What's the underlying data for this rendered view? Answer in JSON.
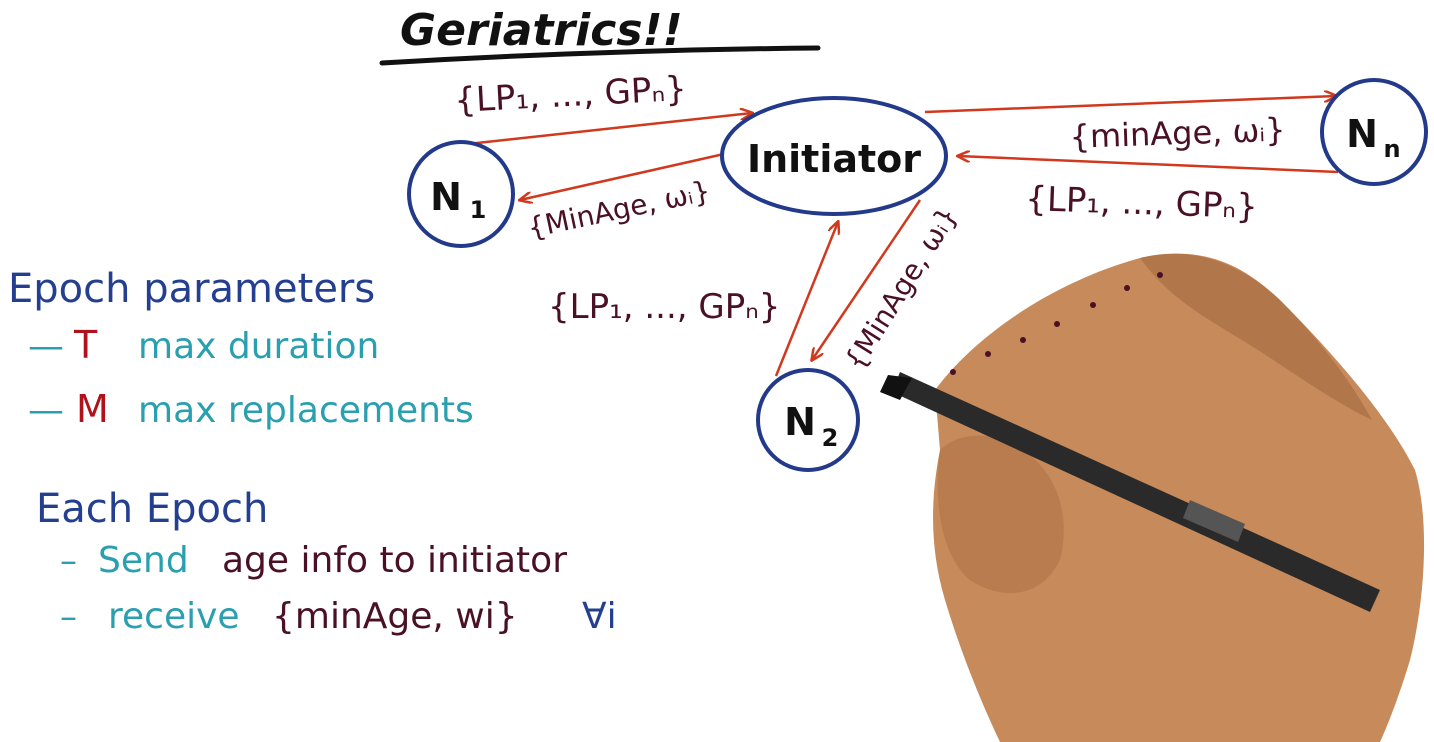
{
  "title": "Geriatrics!!",
  "nodes": {
    "initiator": "Initiator",
    "n1": {
      "base": "N",
      "sub": "1"
    },
    "n2": {
      "base": "N",
      "sub": "2"
    },
    "nn": {
      "base": "N",
      "sub": "n"
    }
  },
  "messages": {
    "n1_to_init": "{LP₁, ..., GPₙ}",
    "init_to_n1": "{MinAge, ωᵢ}",
    "init_to_nn": "{minAge, ωᵢ}",
    "nn_to_init": "{LP₁, ..., GPₙ}",
    "n2_to_init": "{LP₁, ..., GPₙ}",
    "init_to_n2": "{MinAge, ωᵢ}"
  },
  "epoch_parameters": {
    "heading": "Epoch parameters",
    "items": [
      {
        "dash": "—",
        "symbol": "T",
        "text": "max duration"
      },
      {
        "dash": "—",
        "symbol": "M",
        "text": "max replacements"
      }
    ]
  },
  "each_epoch": {
    "heading": "Each Epoch",
    "send": {
      "dash": "–",
      "verb": "Send",
      "rest": "age info to initiator"
    },
    "receive": {
      "dash": "–",
      "verb": "receive",
      "set": "{minAge, wi}",
      "forall": "∀i"
    }
  },
  "colors": {
    "node_stroke": "#233a8b",
    "arrow": "#d0391e",
    "heading_blue": "#243f8f",
    "teal": "#2a9fb0",
    "maroon": "#4a1024",
    "red": "#b0121c"
  }
}
